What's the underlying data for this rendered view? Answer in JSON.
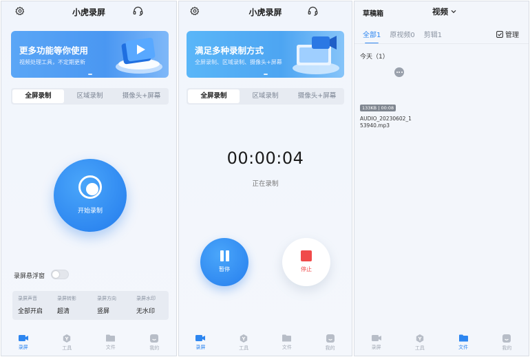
{
  "panel1": {
    "header": {
      "title": "小虎录屏"
    },
    "banner": {
      "title": "更多功能等你使用",
      "subtitle": "视频处理工具，不定期更新"
    },
    "tabs": [
      {
        "label": "全屏录制",
        "active": true
      },
      {
        "label": "区域录制",
        "active": false
      },
      {
        "label": "摄像头+屏幕",
        "active": false
      }
    ],
    "record_button": {
      "label": "开始录制"
    },
    "floating_window": {
      "label": "录屏悬浮窗",
      "enabled": false
    },
    "settings": [
      {
        "label": "录屏声音",
        "value": "全部开启"
      },
      {
        "label": "录屏转影",
        "value": "超清"
      },
      {
        "label": "录屏方向",
        "value": "竖屏"
      },
      {
        "label": "录屏水印",
        "value": "无水印"
      }
    ]
  },
  "panel2": {
    "header": {
      "title": "小虎录屏"
    },
    "banner": {
      "title": "满足多种录制方式",
      "subtitle": "全屏录制、区域录制、摄像头+屏幕"
    },
    "tabs": [
      {
        "label": "全屏录制",
        "active": true
      },
      {
        "label": "区域录制",
        "active": false
      },
      {
        "label": "摄像头+屏幕",
        "active": false
      }
    ],
    "timer": "00:00:04",
    "status": "正在录制",
    "pause_label": "暂停",
    "stop_label": "停止"
  },
  "panel3": {
    "title": "草稿箱",
    "filter": "视频",
    "tabs": [
      {
        "label": "全部1",
        "active": true
      },
      {
        "label": "原视频0",
        "active": false
      },
      {
        "label": "剪辑1",
        "active": false
      }
    ],
    "manage_label": "管理",
    "group_label": "今天（1）",
    "file": {
      "meta": "133KB | 00:08",
      "name": "AUDIO_20230602_153940.mp3"
    }
  },
  "nav": {
    "items": [
      {
        "label": "录屏",
        "icon": "camera-icon"
      },
      {
        "label": "工具",
        "icon": "tools-icon"
      },
      {
        "label": "文件",
        "icon": "folder-icon"
      },
      {
        "label": "我的",
        "icon": "profile-icon"
      }
    ],
    "active_by_panel": [
      "录屏",
      "录屏",
      "文件"
    ]
  },
  "colors": {
    "accent": "#2D86F0",
    "stop": "#F04A4A",
    "inactive": "#A3AAB5"
  }
}
